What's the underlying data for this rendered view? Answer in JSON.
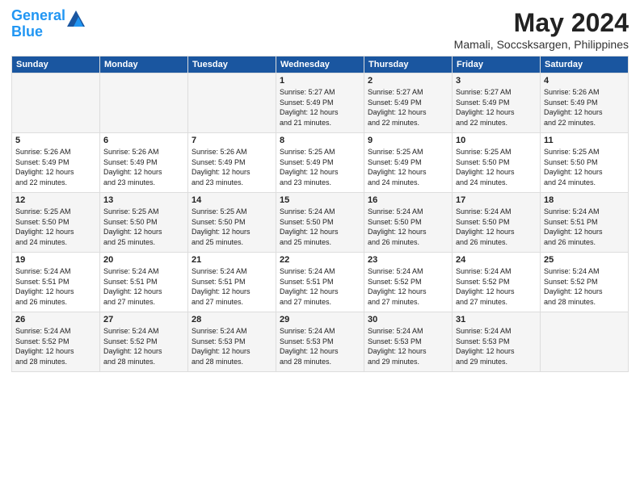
{
  "logo": {
    "line1": "General",
    "line2": "Blue"
  },
  "title": "May 2024",
  "location": "Mamali, Soccsksargen, Philippines",
  "days_of_week": [
    "Sunday",
    "Monday",
    "Tuesday",
    "Wednesday",
    "Thursday",
    "Friday",
    "Saturday"
  ],
  "weeks": [
    [
      {
        "day": "",
        "info": ""
      },
      {
        "day": "",
        "info": ""
      },
      {
        "day": "",
        "info": ""
      },
      {
        "day": "1",
        "info": "Sunrise: 5:27 AM\nSunset: 5:49 PM\nDaylight: 12 hours\nand 21 minutes."
      },
      {
        "day": "2",
        "info": "Sunrise: 5:27 AM\nSunset: 5:49 PM\nDaylight: 12 hours\nand 22 minutes."
      },
      {
        "day": "3",
        "info": "Sunrise: 5:27 AM\nSunset: 5:49 PM\nDaylight: 12 hours\nand 22 minutes."
      },
      {
        "day": "4",
        "info": "Sunrise: 5:26 AM\nSunset: 5:49 PM\nDaylight: 12 hours\nand 22 minutes."
      }
    ],
    [
      {
        "day": "5",
        "info": "Sunrise: 5:26 AM\nSunset: 5:49 PM\nDaylight: 12 hours\nand 22 minutes."
      },
      {
        "day": "6",
        "info": "Sunrise: 5:26 AM\nSunset: 5:49 PM\nDaylight: 12 hours\nand 23 minutes."
      },
      {
        "day": "7",
        "info": "Sunrise: 5:26 AM\nSunset: 5:49 PM\nDaylight: 12 hours\nand 23 minutes."
      },
      {
        "day": "8",
        "info": "Sunrise: 5:25 AM\nSunset: 5:49 PM\nDaylight: 12 hours\nand 23 minutes."
      },
      {
        "day": "9",
        "info": "Sunrise: 5:25 AM\nSunset: 5:49 PM\nDaylight: 12 hours\nand 24 minutes."
      },
      {
        "day": "10",
        "info": "Sunrise: 5:25 AM\nSunset: 5:50 PM\nDaylight: 12 hours\nand 24 minutes."
      },
      {
        "day": "11",
        "info": "Sunrise: 5:25 AM\nSunset: 5:50 PM\nDaylight: 12 hours\nand 24 minutes."
      }
    ],
    [
      {
        "day": "12",
        "info": "Sunrise: 5:25 AM\nSunset: 5:50 PM\nDaylight: 12 hours\nand 24 minutes."
      },
      {
        "day": "13",
        "info": "Sunrise: 5:25 AM\nSunset: 5:50 PM\nDaylight: 12 hours\nand 25 minutes."
      },
      {
        "day": "14",
        "info": "Sunrise: 5:25 AM\nSunset: 5:50 PM\nDaylight: 12 hours\nand 25 minutes."
      },
      {
        "day": "15",
        "info": "Sunrise: 5:24 AM\nSunset: 5:50 PM\nDaylight: 12 hours\nand 25 minutes."
      },
      {
        "day": "16",
        "info": "Sunrise: 5:24 AM\nSunset: 5:50 PM\nDaylight: 12 hours\nand 26 minutes."
      },
      {
        "day": "17",
        "info": "Sunrise: 5:24 AM\nSunset: 5:50 PM\nDaylight: 12 hours\nand 26 minutes."
      },
      {
        "day": "18",
        "info": "Sunrise: 5:24 AM\nSunset: 5:51 PM\nDaylight: 12 hours\nand 26 minutes."
      }
    ],
    [
      {
        "day": "19",
        "info": "Sunrise: 5:24 AM\nSunset: 5:51 PM\nDaylight: 12 hours\nand 26 minutes."
      },
      {
        "day": "20",
        "info": "Sunrise: 5:24 AM\nSunset: 5:51 PM\nDaylight: 12 hours\nand 27 minutes."
      },
      {
        "day": "21",
        "info": "Sunrise: 5:24 AM\nSunset: 5:51 PM\nDaylight: 12 hours\nand 27 minutes."
      },
      {
        "day": "22",
        "info": "Sunrise: 5:24 AM\nSunset: 5:51 PM\nDaylight: 12 hours\nand 27 minutes."
      },
      {
        "day": "23",
        "info": "Sunrise: 5:24 AM\nSunset: 5:52 PM\nDaylight: 12 hours\nand 27 minutes."
      },
      {
        "day": "24",
        "info": "Sunrise: 5:24 AM\nSunset: 5:52 PM\nDaylight: 12 hours\nand 27 minutes."
      },
      {
        "day": "25",
        "info": "Sunrise: 5:24 AM\nSunset: 5:52 PM\nDaylight: 12 hours\nand 28 minutes."
      }
    ],
    [
      {
        "day": "26",
        "info": "Sunrise: 5:24 AM\nSunset: 5:52 PM\nDaylight: 12 hours\nand 28 minutes."
      },
      {
        "day": "27",
        "info": "Sunrise: 5:24 AM\nSunset: 5:52 PM\nDaylight: 12 hours\nand 28 minutes."
      },
      {
        "day": "28",
        "info": "Sunrise: 5:24 AM\nSunset: 5:53 PM\nDaylight: 12 hours\nand 28 minutes."
      },
      {
        "day": "29",
        "info": "Sunrise: 5:24 AM\nSunset: 5:53 PM\nDaylight: 12 hours\nand 28 minutes."
      },
      {
        "day": "30",
        "info": "Sunrise: 5:24 AM\nSunset: 5:53 PM\nDaylight: 12 hours\nand 29 minutes."
      },
      {
        "day": "31",
        "info": "Sunrise: 5:24 AM\nSunset: 5:53 PM\nDaylight: 12 hours\nand 29 minutes."
      },
      {
        "day": "",
        "info": ""
      }
    ]
  ]
}
